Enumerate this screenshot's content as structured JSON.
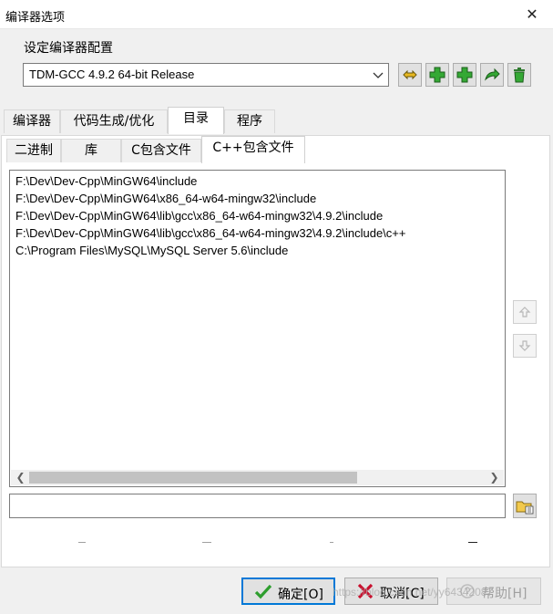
{
  "window": {
    "title": "编译器选项",
    "close_glyph": "✕"
  },
  "config": {
    "group_label": "设定编译器配置",
    "selected": "TDM-GCC 4.9.2 64-bit Release",
    "toolbar_icons": [
      "rename-icon",
      "add-icon",
      "add-copy-icon",
      "export-icon",
      "delete-icon"
    ]
  },
  "main_tabs": [
    {
      "label": "编译器",
      "active": false
    },
    {
      "label": "代码生成/优化",
      "active": false
    },
    {
      "label": "目录",
      "active": true
    },
    {
      "label": "程序",
      "active": false
    }
  ],
  "sub_tabs": [
    {
      "label": "二进制",
      "active": false
    },
    {
      "label": "库",
      "active": false
    },
    {
      "label": "C包含文件",
      "active": false
    },
    {
      "label": "C++包含文件",
      "active": true
    }
  ],
  "include_dirs": [
    "F:\\Dev\\Dev-Cpp\\MinGW64\\include",
    "F:\\Dev\\Dev-Cpp\\MinGW64\\x86_64-w64-mingw32\\include",
    "F:\\Dev\\Dev-Cpp\\MinGW64\\lib\\gcc\\x86_64-w64-mingw32\\4.9.2\\include",
    "F:\\Dev\\Dev-Cpp\\MinGW64\\lib\\gcc\\x86_64-w64-mingw32\\4.9.2\\include\\c++",
    "C:\\Program Files\\MySQL\\MySQL Server 5.6\\include"
  ],
  "path_input": {
    "value": ""
  },
  "buttons": {
    "ok": "确定[O]",
    "cancel": "取消[C]",
    "help": "帮助[H]"
  },
  "watermark": "https://blog.csdn.net/yy64342087",
  "colors": {
    "accent": "#0078d7",
    "icon_green": "#2e9e2e",
    "cancel_red": "#c8102e"
  }
}
